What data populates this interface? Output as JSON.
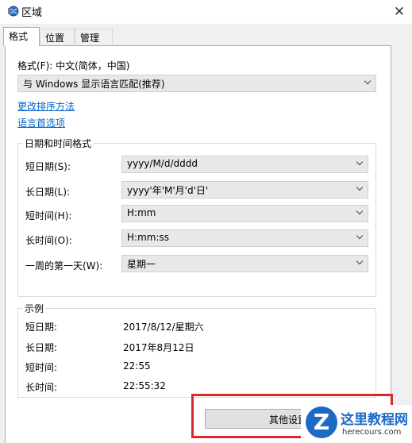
{
  "window": {
    "title": "区域"
  },
  "tabs": [
    "格式",
    "位置",
    "管理"
  ],
  "format": {
    "label": "格式(F): 中文(简体，中国)",
    "value": "与 Windows 显示语言匹配(推荐)"
  },
  "links": {
    "sort": "更改排序方法",
    "language": "语言首选项"
  },
  "datetime": {
    "title": "日期和时间格式",
    "rows": [
      {
        "label": "短日期(S):",
        "value": "yyyy/M/d/dddd"
      },
      {
        "label": "长日期(L):",
        "value": "yyyy'年'M'月'd'日'"
      },
      {
        "label": "短时间(H):",
        "value": "H:mm"
      },
      {
        "label": "长时间(O):",
        "value": "H:mm:ss"
      },
      {
        "label": "一周的第一天(W):",
        "value": "星期一"
      }
    ]
  },
  "example": {
    "title": "示例",
    "rows": [
      {
        "label": "短日期:",
        "value": "2017/8/12/星期六"
      },
      {
        "label": "长日期:",
        "value": "2017年8月12日"
      },
      {
        "label": "短时间:",
        "value": "22:55"
      },
      {
        "label": "长时间:",
        "value": "22:55:32"
      }
    ]
  },
  "other_settings_button": "其他设置",
  "watermark": {
    "logo": "Z",
    "title": "这里教程网",
    "sub": "herecours.com"
  },
  "colors": {
    "link": "#0066cc",
    "highlight": "#d9272e",
    "brand": "#1d69c6"
  }
}
